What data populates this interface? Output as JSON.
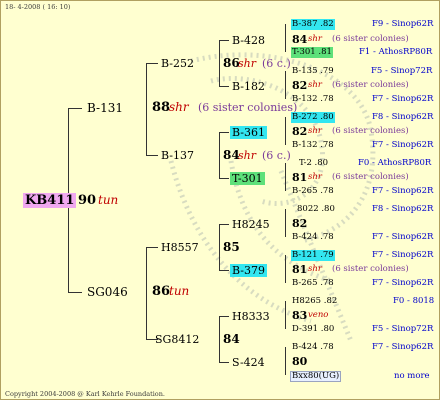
{
  "header": {
    "date": "18-  4-2008 ( 16: 10)"
  },
  "footer": {
    "copyright": "Copyright 2004-2008 @ Karl Kehrle Foundation."
  },
  "root": {
    "id": "KB411",
    "score": "90",
    "tag": "tun"
  },
  "gen1": [
    {
      "id": "B-131",
      "score": "88",
      "tag": "shr",
      "note": "(6 sister colonies)"
    },
    {
      "id": "SG046",
      "score": "86",
      "tag": "tun"
    }
  ],
  "gen2": [
    {
      "id": "B-252",
      "score": "86",
      "tag": "shr",
      "note": "(6 c.)"
    },
    {
      "id": "B-137",
      "score": "84",
      "tag": "shr",
      "note": "(6 c.)"
    },
    {
      "id": "H8557",
      "score": "85"
    },
    {
      "id": "SG8412",
      "score": "84"
    }
  ],
  "gen3": [
    {
      "id": "B-428"
    },
    {
      "id": "B-182"
    },
    {
      "id": "B-361",
      "highlight": "cyan"
    },
    {
      "id": "T-301",
      "highlight": "green"
    },
    {
      "id": "H8245"
    },
    {
      "id": "B-379",
      "highlight": "cyan"
    },
    {
      "id": "H8333"
    },
    {
      "id": "S-424"
    }
  ],
  "gen4": [
    {
      "top": "B-387 .82",
      "top_hl": "cyan",
      "mid": "84",
      "tag": "shr",
      "note": "(6 sister colonies)",
      "bot": "T-301 .81",
      "bot_hl": "green",
      "top_r": "F9 - Sinop62R",
      "bot_r": "F1 - AthosRP80R"
    },
    {
      "top": "B-135 .79",
      "mid": "82",
      "tag": "shr",
      "note": "(6 sister colonies)",
      "bot": "B-132 .78",
      "top_r": "F5 - Sinop72R",
      "bot_r": "F7 - Sinop62R"
    },
    {
      "top": "B-272 .80",
      "top_hl": "cyan",
      "mid": "82",
      "tag": "shr",
      "note": "(6 sister colonies)",
      "bot": "B-132 .78",
      "top_r": "F8 - Sinop62R",
      "bot_r": "F7 - Sinop62R"
    },
    {
      "top": "T-2 .80",
      "mid": "81",
      "tag": "shr",
      "note": "(6 sister colonies)",
      "bot": "B-265 .78",
      "top_r": "F0 - AthosRP80R",
      "bot_r": "F7 - Sinop62R"
    },
    {
      "top": "8022 .80",
      "mid": "82",
      "bot": "B-424 .78",
      "top_r": "F8 - Sinop62R",
      "bot_r": "F7 - Sinop62R"
    },
    {
      "top": "B-121 .79",
      "top_hl": "cyan",
      "mid": "81",
      "tag": "shr",
      "note": "(6 sister colonies)",
      "bot": "B-265 .78",
      "top_r": "F7 - Sinop62R",
      "bot_r": "F7 - Sinop62R"
    },
    {
      "top": "H8265 .82",
      "mid": "83",
      "tag": "veno",
      "bot": "D-391 .80",
      "top_r": "F0 - 8018",
      "bot_r": "F5 - Sinop72R"
    },
    {
      "top": "B-424 .78",
      "mid": "80",
      "bot": "Bxx80(UG)",
      "top_r": "F7 - Sinop62R",
      "bot_r": "no more"
    }
  ]
}
